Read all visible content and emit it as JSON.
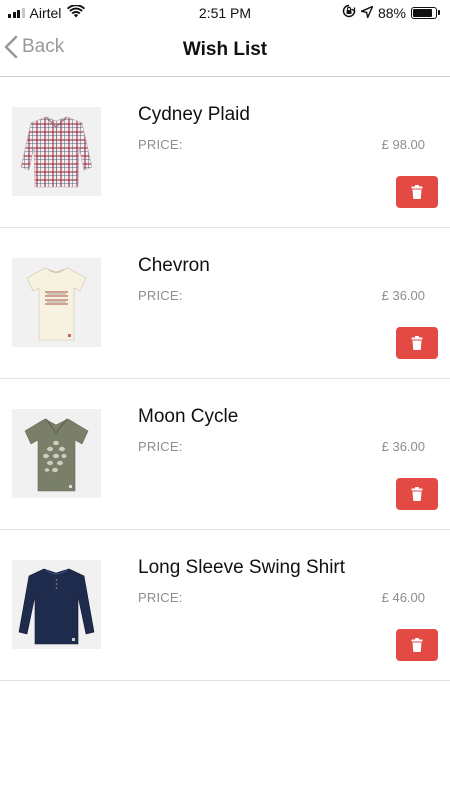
{
  "status_bar": {
    "carrier": "Airtel",
    "time": "2:51 PM",
    "battery": "88%",
    "battery_level": 0.88,
    "icons": [
      "signal-icon",
      "wifi-icon",
      "orientation-lock-icon",
      "location-arrow-icon",
      "battery-icon"
    ]
  },
  "nav": {
    "back_label": "Back",
    "title": "Wish List",
    "back_icon": "chevron-left-icon"
  },
  "colors": {
    "delete_button": "#e34a44",
    "back_text": "#9a9a9a",
    "price_text": "#8e8e8e"
  },
  "items": [
    {
      "name": "Cydney Plaid",
      "price_label": "PRICE:",
      "price": "£ 98.00",
      "image": "plaid-shirt",
      "action_icon": "trash-icon"
    },
    {
      "name": "Chevron",
      "price_label": "PRICE:",
      "price": "£ 36.00",
      "image": "cream-tshirt",
      "action_icon": "trash-icon"
    },
    {
      "name": "Moon Cycle",
      "price_label": "PRICE:",
      "price": "£ 36.00",
      "image": "olive-tshirt",
      "action_icon": "trash-icon"
    },
    {
      "name": "Long Sleeve Swing Shirt",
      "price_label": "PRICE:",
      "price": "£ 46.00",
      "image": "navy-longsleeve",
      "action_icon": "trash-icon"
    }
  ]
}
